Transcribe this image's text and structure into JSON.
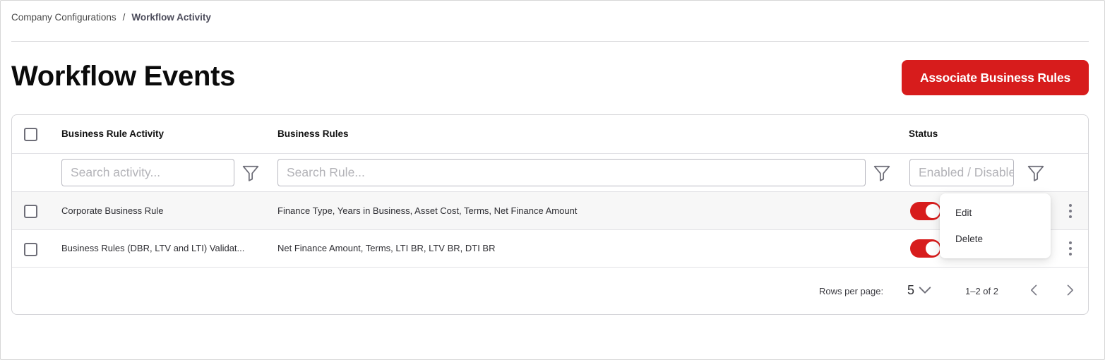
{
  "breadcrumb": {
    "parent": "Company Configurations",
    "separator": "/",
    "current": "Workflow Activity"
  },
  "page": {
    "title": "Workflow Events",
    "primary_action": "Associate Business Rules"
  },
  "colors": {
    "accent": "#d71c1c",
    "border": "#d4d4d8",
    "row_hover": "#f7f7f7"
  },
  "table": {
    "columns": [
      "Business Rule Activity",
      "Business Rules",
      "Status"
    ],
    "filters": {
      "activity_placeholder": "Search activity...",
      "rule_placeholder": "Search Rule...",
      "status_placeholder": "Enabled / Disabled",
      "icon": "filter-icon"
    },
    "rows": [
      {
        "activity": "Corporate Business Rule",
        "rules": "Finance Type, Years in Business, Asset Cost, Terms, Net Finance Amount",
        "enabled": true
      },
      {
        "activity": "Business Rules (DBR, LTV and LTI) Validat...",
        "rules": "Net Finance Amount, Terms, LTI BR, LTV BR, DTI BR",
        "enabled": true
      }
    ],
    "row_menu": {
      "edit": "Edit",
      "delete": "Delete"
    },
    "footer": {
      "rows_per_page_label": "Rows per page:",
      "rows_per_page_value": "5",
      "range": "1–2 of 2"
    }
  }
}
